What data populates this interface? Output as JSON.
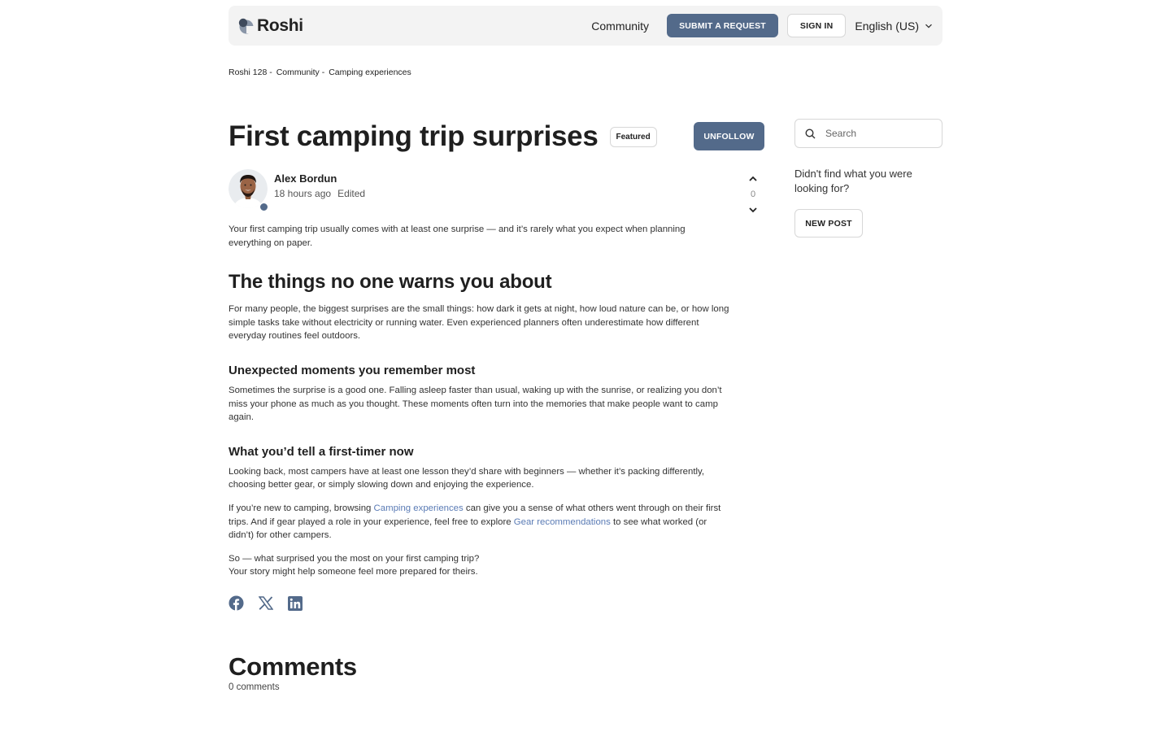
{
  "header": {
    "logo_text": "Roshi",
    "nav_community": "Community",
    "submit_request": "SUBMIT A REQUEST",
    "sign_in": "SIGN IN",
    "language": "English (US)"
  },
  "breadcrumb": [
    "Roshi 128 -",
    "Community -",
    "Camping experiences"
  ],
  "post": {
    "title": "First camping trip surprises",
    "badge": "Featured",
    "unfollow": "UNFOLLOW",
    "author_name": "Alex Bordun",
    "time": "18 hours ago",
    "edited": "Edited",
    "vote_count": "0",
    "intro": "Your first camping trip usually comes with at least one surprise — and it’s rarely what you expect when planning everything on paper.",
    "h2": "The things no one warns you about",
    "p1": "For many people, the biggest surprises are the small things: how dark it gets at night, how loud nature can be, or how long simple tasks take without electricity or running water. Even experienced planners often underestimate how different everyday routines feel outdoors.",
    "h3a": "Unexpected moments you remember most",
    "p2": "Sometimes the surprise is a good one. Falling asleep faster than usual, waking up with the sunrise, or realizing you don’t miss your phone as much as you thought. These moments often turn into the memories that make people want to camp again.",
    "h3b": "What you’d tell a first-timer now",
    "p3": "Looking back, most campers have at least one lesson they’d share with beginners — whether it’s packing differently, choosing better gear, or simply slowing down and enjoying the experience.",
    "p4_a": "If you’re new to camping, browsing ",
    "p4_link1": "Camping experiences",
    "p4_b": " can give you a sense of what others went through on their first trips. And if gear played a role in your experience, feel free to explore ",
    "p4_link2": "Gear recommendations",
    "p4_c": " to see what worked (or didn’t) for other campers.",
    "p5_line1": "So — what surprised you the most on your first camping trip?",
    "p5_line2": "Your story might help someone feel more prepared for theirs."
  },
  "share_icons": [
    "facebook-icon",
    "x-icon",
    "linkedin-icon"
  ],
  "comments": {
    "title": "Comments",
    "count": "0 comments"
  },
  "sidebar": {
    "search_placeholder": "Search",
    "prompt": "Didn't find what you were looking for?",
    "new_post": "NEW POST"
  },
  "colors": {
    "accent": "#536a8a",
    "link": "#5a7bb5",
    "header_bg": "#f3f3f3"
  }
}
